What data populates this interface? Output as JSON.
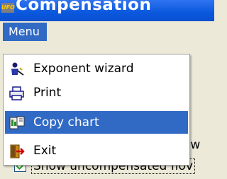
{
  "window": {
    "title": "Compensation",
    "app_icon_text": "UFO"
  },
  "menubar": {
    "menu_label": "Menu"
  },
  "menu": {
    "items": [
      {
        "label": "Exponent wizard",
        "icon": "wizard-person-icon",
        "selected": false
      },
      {
        "label": "Print",
        "icon": "printer-icon",
        "selected": false
      },
      {
        "label": "Copy chart",
        "icon": "copy-chart-icon",
        "selected": true
      },
      {
        "label": "Exit",
        "icon": "exit-door-icon",
        "selected": false
      }
    ]
  },
  "background": {
    "partial_text_1": "ow",
    "checkbox_label": "Show uncompensated flov",
    "checkbox_checked": true
  },
  "colors": {
    "title_bar": "#0a58de",
    "menu_highlight": "#316ac5",
    "window_bg": "#ece9d8"
  }
}
